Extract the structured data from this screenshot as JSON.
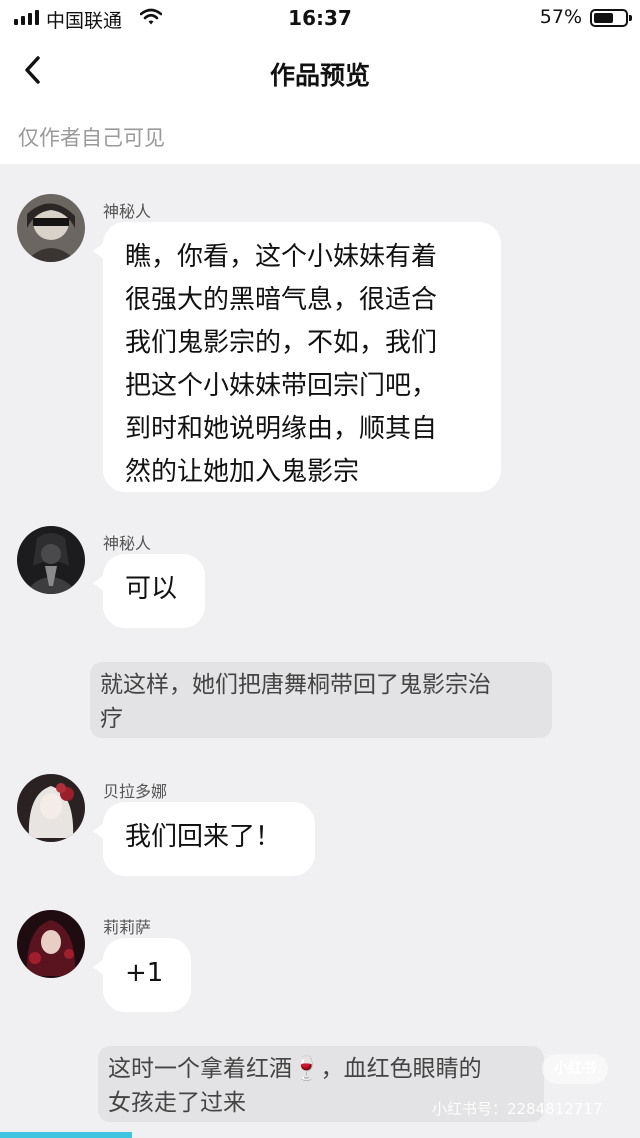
{
  "status_bar": {
    "carrier": "中国联通",
    "time": "16:37",
    "battery": "57%"
  },
  "header": {
    "title": "作品预览",
    "back_icon": "chevron-left-icon"
  },
  "visibility_note": "仅作者自己可见",
  "messages": [
    {
      "sender": "神秘人",
      "text_lines": [
        "瞧，你看，这个小妹妹有着",
        "很强大的黑暗气息，很适合",
        "我们鬼影宗的，不如，我们",
        "把这个小妹妹带回宗门吧，",
        "到时和她说明缘由，顺其自",
        "然的让她加入鬼影宗"
      ]
    },
    {
      "sender": "神秘人",
      "text": "可以"
    },
    {
      "narration_lines": [
        "就这样，她们把唐舞桐带回了鬼影宗治",
        "疗"
      ]
    },
    {
      "sender": "贝拉多娜",
      "text": "我们回来了！"
    },
    {
      "sender": "莉莉萨",
      "text": "+1"
    },
    {
      "narration_lines": [
        "这时一个拿着红酒🍷，血红色眼睛的",
        "女孩走了过来"
      ]
    }
  ],
  "watermark": {
    "logo": "小红书",
    "id": "小红书号：2284812717"
  },
  "colors": {
    "background": "#f0f0f2",
    "bubble": "#ffffff",
    "narration": "#e3e3e5",
    "progress": "#3fc5e0"
  }
}
